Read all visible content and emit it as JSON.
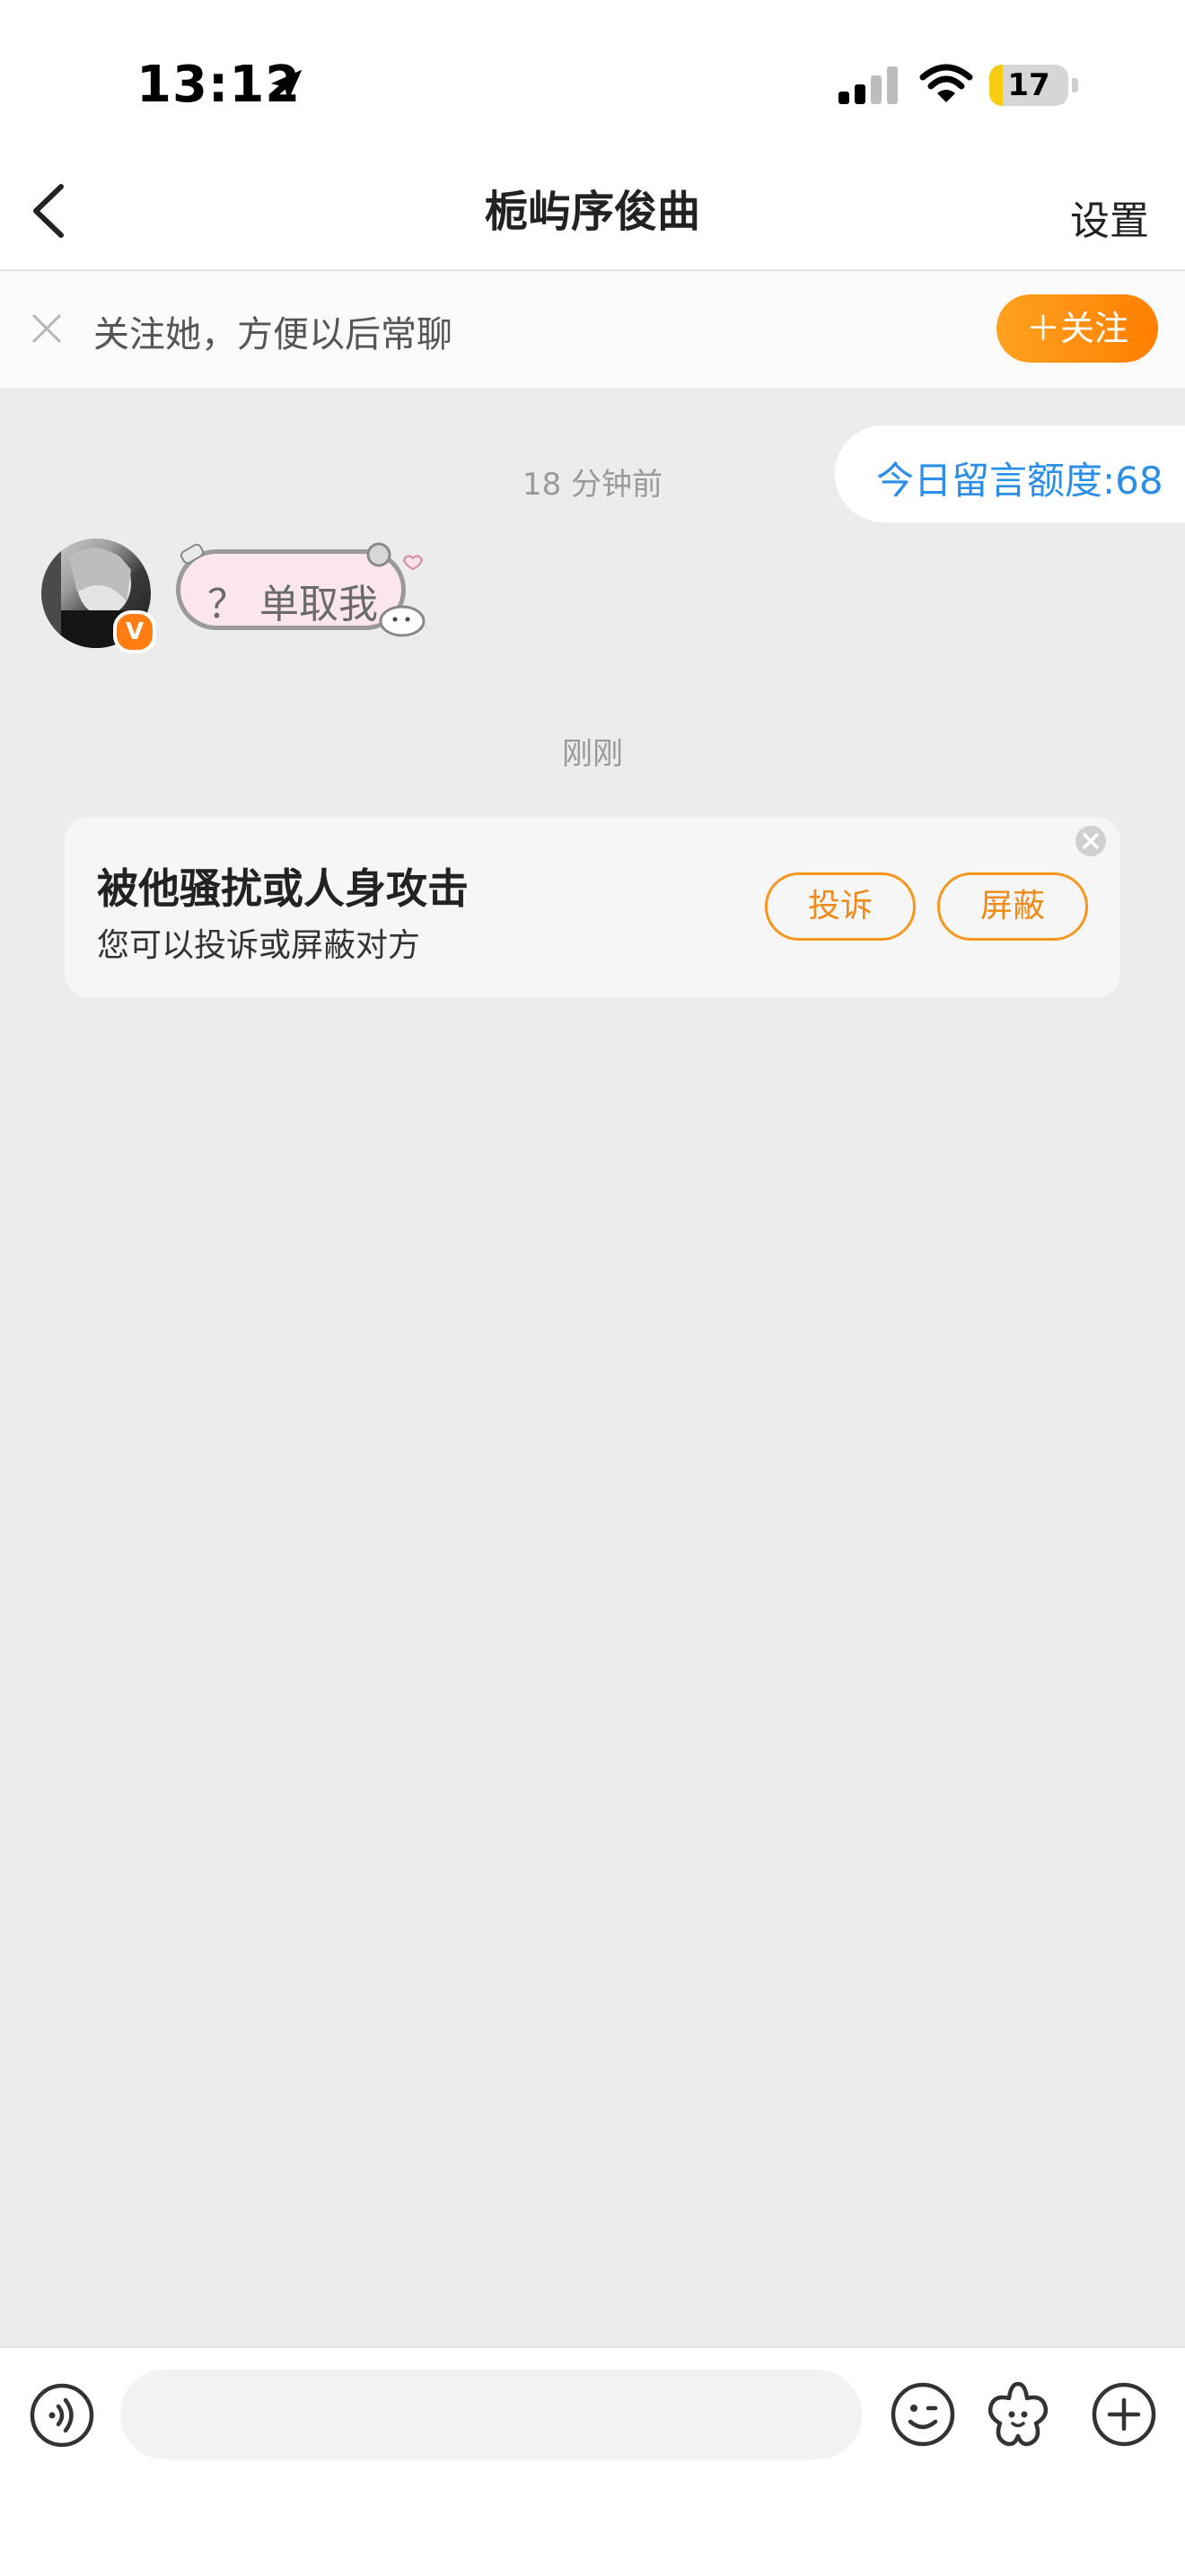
{
  "status_bar": {
    "time": "13:12",
    "battery_level": "17",
    "icons": [
      "location-arrow-icon",
      "cellular-signal-icon",
      "wifi-icon",
      "battery-icon"
    ]
  },
  "header": {
    "title": "栀屿序俊曲",
    "settings_label": "设置",
    "back_icon": "chevron-left-icon"
  },
  "follow_banner": {
    "text": "关注她，方便以后常聊",
    "button_label": "＋关注",
    "close_icon": "close-icon"
  },
  "chat": {
    "quota_label": "今日留言额度:68",
    "timestamp_1": "18 分钟前",
    "message_1": {
      "text": "？ 单取我",
      "sender_verified_badge": "V"
    },
    "timestamp_2": "刚刚"
  },
  "harassment_card": {
    "title": "被他骚扰或人身攻击",
    "subtitle": "您可以投诉或屏蔽对方",
    "report_label": "投诉",
    "block_label": "屏蔽"
  },
  "input_bar": {
    "placeholder": "",
    "icons": [
      "voice-icon",
      "emoji-icon",
      "sticker-icon",
      "plus-icon"
    ]
  },
  "colors": {
    "accent_orange": "#ff8a00",
    "quota_blue": "#2b8fe8",
    "chat_background": "#ececec"
  }
}
